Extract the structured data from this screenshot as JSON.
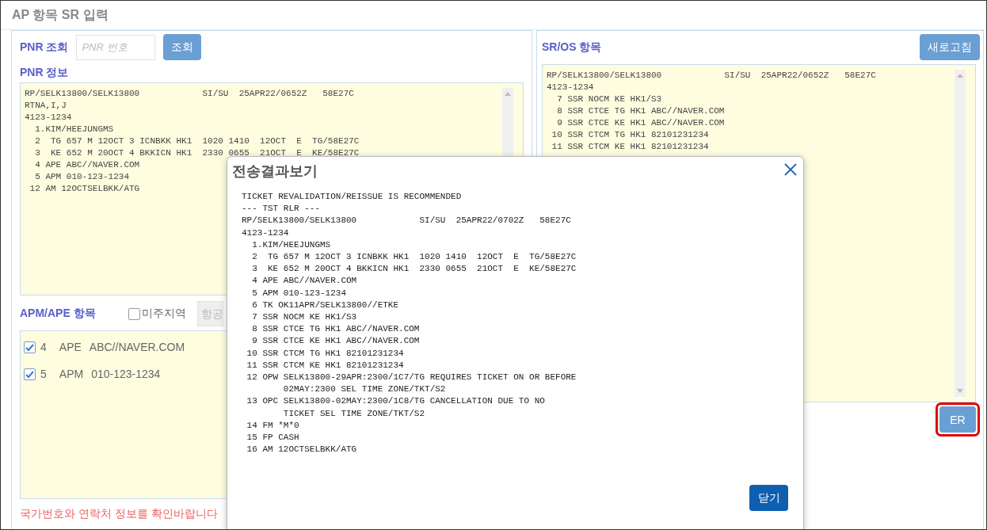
{
  "page": {
    "title": "AP 항목 SR 입력"
  },
  "pnr_search": {
    "label": "PNR 조회",
    "placeholder": "PNR 번호",
    "button": "조회"
  },
  "pnr_info": {
    "label": "PNR 정보",
    "lines": [
      "RP/SELK13800/SELK13800            SI/SU  25APR22/0652Z   58E27C",
      "RTNA,I,J",
      "4123-1234",
      "  1.KIM/HEEJUNGMS",
      "  2  TG 657 M 12OCT 3 ICNBKK HK1  1020 1410  12OCT  E  TG/58E27C",
      "  3  KE 652 M 20OCT 4 BKKICN HK1  2330 0655  21OCT  E  KE/58E27C",
      "  4 APE ABC//NAVER.COM",
      "  5 APM 010-123-1234",
      " 12 AM 12OCTSELBKK/ATG"
    ]
  },
  "apm_ape": {
    "label": "APM/APE 항목",
    "region_checkbox": {
      "label": "미주지역",
      "checked": false
    },
    "airline_field": {
      "placeholder": "항공"
    },
    "items": [
      {
        "number": "4",
        "type": "APE",
        "value": "ABC//NAVER.COM",
        "checked": true
      },
      {
        "number": "5",
        "type": "APM",
        "value": "010-123-1234",
        "checked": true
      }
    ]
  },
  "warning": "국가번호와 연락처 정보를 확인바랍니다",
  "sr_os": {
    "label": "SR/OS 항목",
    "refresh_button": "새로고침",
    "lines": [
      "RP/SELK13800/SELK13800            SI/SU  25APR22/0652Z   58E27C",
      "4123-1234",
      "  7 SSR NOCM KE HK1/S3",
      "  8 SSR CTCE TG HK1 ABC//NAVER.COM",
      "  9 SSR CTCE KE HK1 ABC//NAVER.COM",
      " 10 SSR CTCM TG HK1 82101231234",
      " 11 SSR CTCM KE HK1 82101231234"
    ],
    "er_button": {
      "label": "ER",
      "highlighted": true
    }
  },
  "dialog": {
    "title": "전송결과보기",
    "lines": [
      "TICKET REVALIDATION/REISSUE IS RECOMMENDED",
      "--- TST RLR ---",
      "RP/SELK13800/SELK13800            SI/SU  25APR22/0702Z   58E27C",
      "4123-1234",
      "  1.KIM/HEEJUNGMS",
      "  2  TG 657 M 12OCT 3 ICNBKK HK1  1020 1410  12OCT  E  TG/58E27C",
      "  3  KE 652 M 20OCT 4 BKKICN HK1  2330 0655  21OCT  E  KE/58E27C",
      "  4 APE ABC//NAVER.COM",
      "  5 APM 010-123-1234",
      "  6 TK OK11APR/SELK13800//ETKE",
      "  7 SSR NOCM KE HK1/S3",
      "  8 SSR CTCE TG HK1 ABC//NAVER.COM",
      "  9 SSR CTCE KE HK1 ABC//NAVER.COM",
      " 10 SSR CTCM TG HK1 82101231234",
      " 11 SSR CTCM KE HK1 82101231234",
      " 12 OPW SELK13800-29APR:2300/1C7/TG REQUIRES TICKET ON OR BEFORE",
      "        02MAY:2300 SEL TIME ZONE/TKT/S2",
      " 13 OPC SELK13800-02MAY:2300/1C8/TG CANCELLATION DUE TO NO",
      "        TICKET SEL TIME ZONE/TKT/S2",
      " 14 FM *M*0",
      " 15 FP CASH",
      " 16 AM 12OCTSELBKK/ATG"
    ],
    "close_button": "닫기"
  }
}
